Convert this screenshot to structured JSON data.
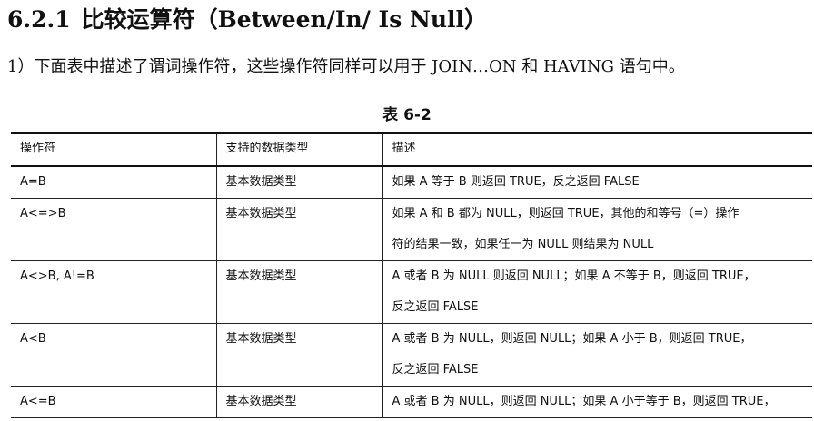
{
  "heading": {
    "number": "6.2.1",
    "title": "比较运算符（Between/In/ Is Null）"
  },
  "paragraph": "1）下面表中描述了谓词操作符，这些操作符同样可以用于 JOIN…ON 和 HAVING 语句中。",
  "caption": "表 6-2",
  "table": {
    "headers": [
      "操作符",
      "支持的数据类型",
      "描述"
    ],
    "rows": [
      {
        "op": "A=B",
        "type": "基本数据类型",
        "desc": [
          "如果 A 等于 B 则返回 TRUE，反之返回 FALSE"
        ]
      },
      {
        "op": "A<=>B",
        "type": "基本数据类型",
        "desc": [
          "如果 A 和 B 都为 NULL，则返回 TRUE，其他的和等号（=）操作",
          "符的结果一致，如果任一为 NULL 则结果为 NULL"
        ]
      },
      {
        "op": "A<>B, A!=B",
        "type": "基本数据类型",
        "desc": [
          "A 或者 B 为 NULL 则返回 NULL；如果 A 不等于 B，则返回 TRUE，",
          "反之返回 FALSE"
        ]
      },
      {
        "op": "A<B",
        "type": "基本数据类型",
        "desc": [
          "A 或者 B 为 NULL，则返回 NULL；如果 A 小于 B，则返回 TRUE，",
          "反之返回 FALSE"
        ]
      },
      {
        "op": "A<=B",
        "type": "基本数据类型",
        "desc": [
          "A 或者 B 为 NULL，则返回 NULL；如果 A 小于等于 B，则返回 TRUE，"
        ]
      }
    ]
  }
}
